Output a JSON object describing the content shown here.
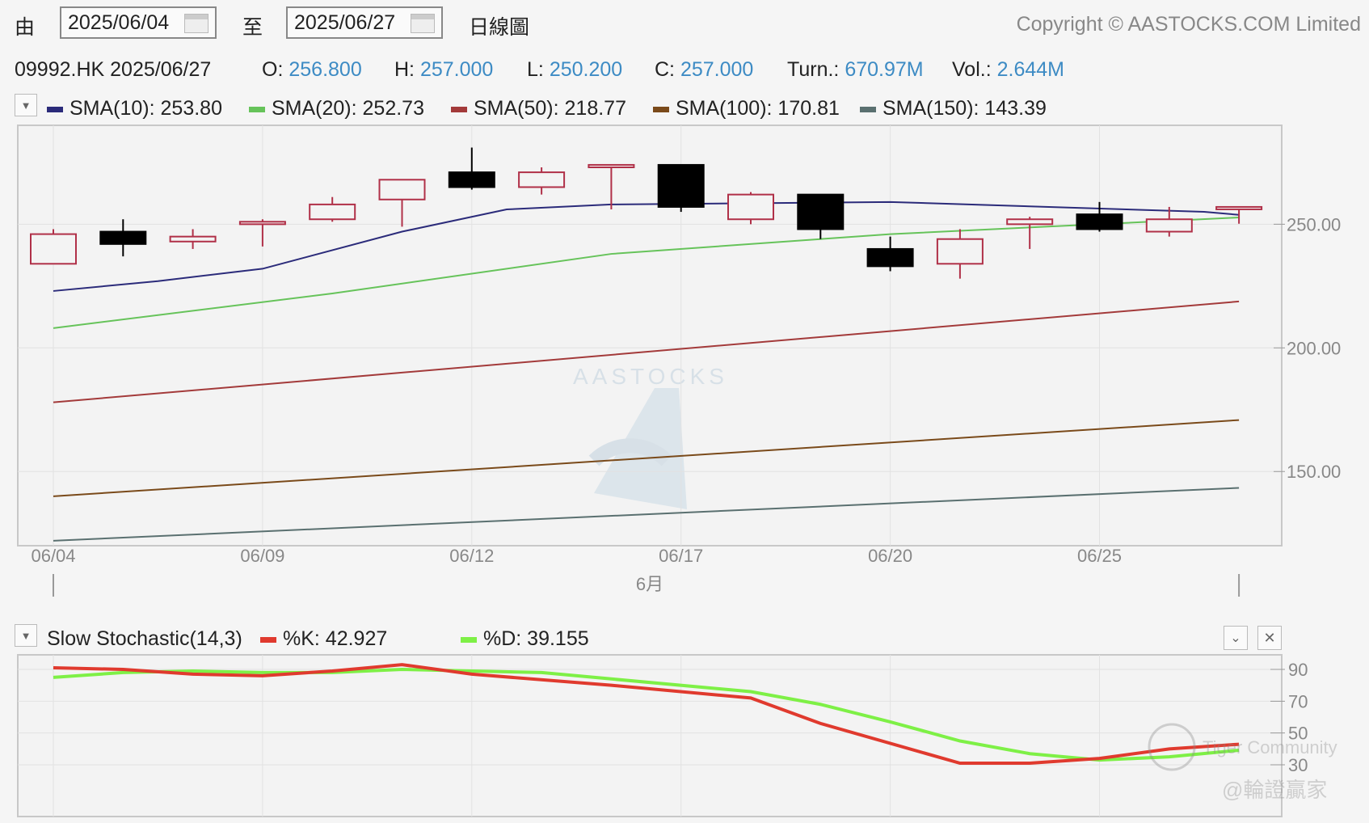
{
  "header": {
    "from_label": "由",
    "from_date": "2025/06/04",
    "to_label": "至",
    "to_date": "2025/06/27",
    "chart_mode": "日線圖",
    "copyright": "Copyright © AASTOCKS.COM Limited"
  },
  "quote": {
    "symbol_date": "09992.HK 2025/06/27",
    "open_label": "O:",
    "open": "256.800",
    "high_label": "H:",
    "high": "257.000",
    "low_label": "L:",
    "low": "250.200",
    "close_label": "C:",
    "close": "257.000",
    "turn_label": "Turn.:",
    "turn": "670.97M",
    "vol_label": "Vol.:",
    "vol": "2.644M"
  },
  "sma_legend": [
    {
      "label": "SMA(10): 253.80",
      "color": "#2b2b7a"
    },
    {
      "label": "SMA(20): 252.73",
      "color": "#66c35a"
    },
    {
      "label": "SMA(50): 218.77",
      "color": "#a33a3a"
    },
    {
      "label": "SMA(100): 170.81",
      "color": "#7a4a1a"
    },
    {
      "label": "SMA(150): 143.39",
      "color": "#5a7070"
    }
  ],
  "stoch_legend": {
    "title": "Slow Stochastic(14,3)",
    "k_label": "%K: 42.927",
    "k_color": "#e03a2e",
    "d_label": "%D: 39.155",
    "d_color": "#7ef046"
  },
  "watermark": {
    "brand": "AASTOCKS",
    "community": "Tiger Community",
    "author": "@輪證贏家"
  },
  "chart_data": [
    {
      "type": "candlestick",
      "x_tick_labels": [
        "06/04",
        "06/09",
        "06/12",
        "06/17",
        "06/20",
        "06/25"
      ],
      "month_label": "6月",
      "ylim": [
        120,
        290
      ],
      "y_ticks": [
        150,
        200,
        250
      ],
      "y_tick_labels": [
        "150.00",
        "200.00",
        "250.00"
      ],
      "candles": [
        {
          "date": "06/04",
          "open": 234,
          "high": 248,
          "low": 234,
          "close": 246
        },
        {
          "date": "06/05",
          "open": 247,
          "high": 252,
          "low": 237,
          "close": 242
        },
        {
          "date": "06/06",
          "open": 243,
          "high": 248,
          "low": 240,
          "close": 245
        },
        {
          "date": "06/09",
          "open": 250,
          "high": 252,
          "low": 241,
          "close": 251
        },
        {
          "date": "06/10",
          "open": 252,
          "high": 261,
          "low": 251,
          "close": 258
        },
        {
          "date": "06/11",
          "open": 260,
          "high": 268,
          "low": 249,
          "close": 268
        },
        {
          "date": "06/12",
          "open": 271,
          "high": 281,
          "low": 264,
          "close": 265
        },
        {
          "date": "06/13",
          "open": 265,
          "high": 273,
          "low": 262,
          "close": 271
        },
        {
          "date": "06/16",
          "open": 273,
          "high": 274,
          "low": 256,
          "close": 274
        },
        {
          "date": "06/17",
          "open": 274,
          "high": 274,
          "low": 255,
          "close": 257
        },
        {
          "date": "06/18",
          "open": 252,
          "high": 263,
          "low": 250,
          "close": 262
        },
        {
          "date": "06/19",
          "open": 262,
          "high": 262,
          "low": 244,
          "close": 248
        },
        {
          "date": "06/20",
          "open": 240,
          "high": 245,
          "low": 231,
          "close": 233
        },
        {
          "date": "06/23",
          "open": 234,
          "high": 248,
          "low": 228,
          "close": 244
        },
        {
          "date": "06/24",
          "open": 250,
          "high": 253,
          "low": 240,
          "close": 252
        },
        {
          "date": "06/25",
          "open": 254,
          "high": 259,
          "low": 247,
          "close": 248
        },
        {
          "date": "06/26",
          "open": 247,
          "high": 257,
          "low": 245,
          "close": 252
        },
        {
          "date": "06/27",
          "open": 256.8,
          "high": 257,
          "low": 250.2,
          "close": 257
        }
      ],
      "sma_series": [
        {
          "name": "SMA(10)",
          "color": "#2b2b7a",
          "values": [
            [
              0,
              223
            ],
            [
              1.5,
              227
            ],
            [
              3,
              232
            ],
            [
              5,
              247
            ],
            [
              6.5,
              256
            ],
            [
              8,
              258
            ],
            [
              12,
              259
            ],
            [
              16.5,
              255
            ],
            [
              17,
              253.8
            ]
          ]
        },
        {
          "name": "SMA(20)",
          "color": "#66c35a",
          "values": [
            [
              0,
              208
            ],
            [
              4,
              222
            ],
            [
              8,
              238
            ],
            [
              12,
              246
            ],
            [
              17,
              252.73
            ]
          ]
        },
        {
          "name": "SMA(50)",
          "color": "#a33a3a",
          "values": [
            [
              0,
              178
            ],
            [
              17,
              218.77
            ]
          ]
        },
        {
          "name": "SMA(100)",
          "color": "#7a4a1a",
          "values": [
            [
              0,
              140
            ],
            [
              17,
              170.81
            ]
          ]
        },
        {
          "name": "SMA(150)",
          "color": "#5a7070",
          "values": [
            [
              0,
              122
            ],
            [
              17,
              143.39
            ]
          ]
        }
      ]
    },
    {
      "type": "line",
      "title": "Slow Stochastic(14,3)",
      "ylim": [
        0,
        100
      ],
      "y_ticks": [
        30,
        50,
        70,
        90
      ],
      "series": [
        {
          "name": "%K",
          "color": "#e03a2e",
          "values": [
            [
              0,
              91
            ],
            [
              1,
              90
            ],
            [
              2,
              87
            ],
            [
              3,
              86
            ],
            [
              4,
              89
            ],
            [
              5,
              93
            ],
            [
              6,
              87
            ],
            [
              8,
              80
            ],
            [
              10,
              72
            ],
            [
              11,
              56
            ],
            [
              13,
              31
            ],
            [
              14,
              31
            ],
            [
              15,
              34
            ],
            [
              16,
              40
            ],
            [
              17,
              42.927
            ]
          ]
        },
        {
          "name": "%D",
          "color": "#7ef046",
          "values": [
            [
              0,
              85
            ],
            [
              1,
              88
            ],
            [
              2,
              89
            ],
            [
              3,
              88
            ],
            [
              4,
              88
            ],
            [
              5,
              90
            ],
            [
              6,
              89
            ],
            [
              7,
              88
            ],
            [
              8,
              84
            ],
            [
              10,
              76
            ],
            [
              11,
              68
            ],
            [
              12,
              57
            ],
            [
              13,
              45
            ],
            [
              14,
              37
            ],
            [
              15,
              33
            ],
            [
              16,
              35
            ],
            [
              17,
              39.155
            ]
          ]
        }
      ]
    }
  ]
}
